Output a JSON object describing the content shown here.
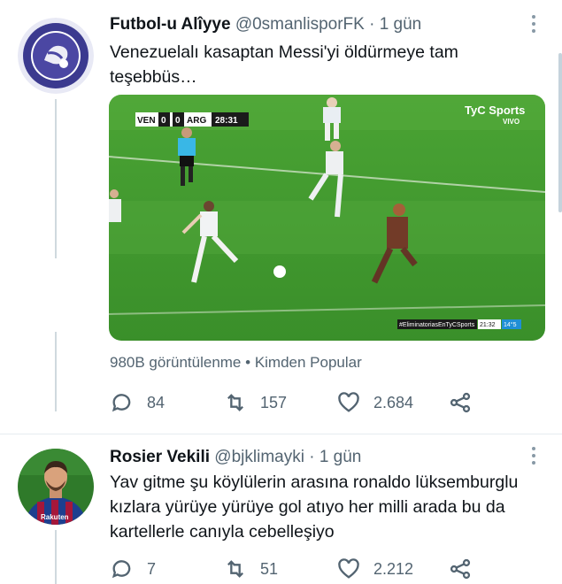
{
  "tweets": [
    {
      "name": "Futbol-u Alîyye",
      "handle": "@0smanlisporFK",
      "separator": "·",
      "time": "1 gün",
      "text": "Venezuelalı kasaptan Messi'yi öldürmeye tam teşebbüs…",
      "avatar_icon": "club-crest-icon",
      "media": {
        "score_home": "VEN",
        "score_home_goals": "0",
        "score_away_goals": "0",
        "score_away": "ARG",
        "clock": "28:31",
        "broadcaster": "TyC Sports",
        "broadcaster_sub": "VIVO",
        "hashtag": "#EliminatoriasEnTyCSports",
        "corner_time": "21:32",
        "corner_extra": "14°5"
      },
      "views": "980B görüntülenme",
      "from_label": "Kimden Popular",
      "replies": "84",
      "retweets": "157",
      "likes": "2.684"
    },
    {
      "name": "Rosier Vekili",
      "handle": "@bjklimayki",
      "separator": "·",
      "time": "1 gün",
      "text": "Yav gitme şu köylülerin arasına ronaldo lüksemburglu kızlara yürüye yürüye gol atıyo her milli arada bu da kartellerle canıyla cebelleşiyo",
      "avatar_icon": "player-avatar-icon",
      "jersey_text": "Rakuten",
      "replies": "7",
      "retweets": "51",
      "likes": "2.212"
    }
  ],
  "colors": {
    "text": "#0f1419",
    "muted": "#536471",
    "divider": "#e6ecf0",
    "pitch": "#3f9a2e"
  }
}
